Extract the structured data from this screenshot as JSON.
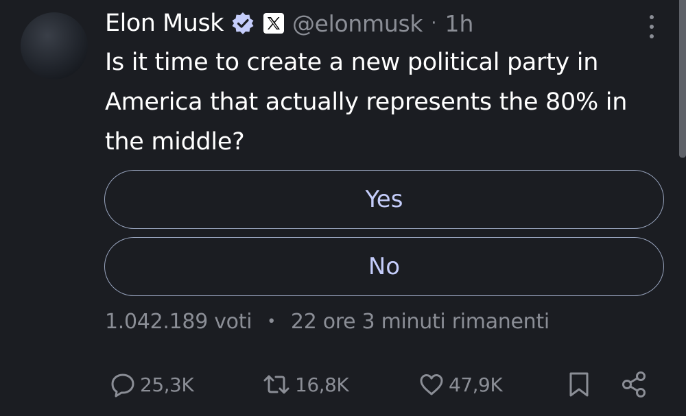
{
  "tweet": {
    "author_name": "Elon Musk",
    "handle": "@elonmusk",
    "separator": "·",
    "time": "1h",
    "text": "Is it time to create a new political party in America that actually represents the 80% in the middle?",
    "x_badge": "𝕏"
  },
  "poll": {
    "options": [
      "Yes",
      "No"
    ],
    "votes": "1.042.189 voti",
    "separator": "•",
    "remaining": "22 ore 3 minuti rimanenti"
  },
  "actions": {
    "replies": "25,3K",
    "retweets": "16,8K",
    "likes": "47,9K"
  },
  "icons": [
    "verified-icon",
    "x-logo-icon",
    "more-options-icon",
    "reply-icon",
    "retweet-icon",
    "like-icon",
    "bookmark-icon",
    "share-icon"
  ],
  "colors": {
    "background": "#1b1d22",
    "text": "#ffffff",
    "muted": "#8b8e96",
    "poll_accent": "#c5cdfb",
    "verified": "#c5cdfb"
  }
}
